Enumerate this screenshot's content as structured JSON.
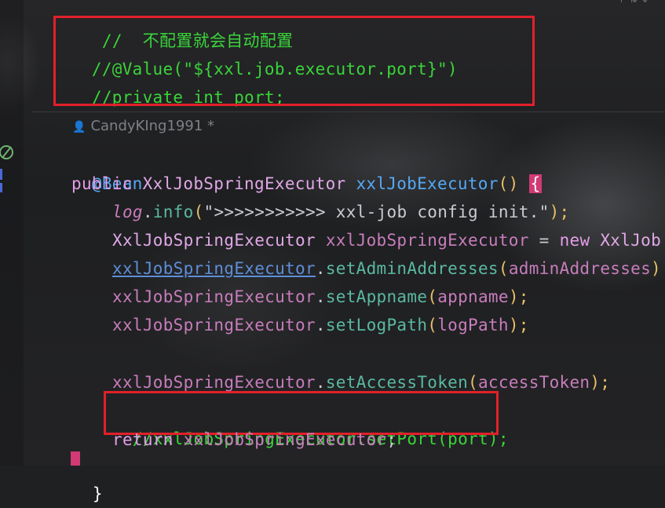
{
  "comment_top": "//  不配置就会自动配置",
  "line_value": "//@Value(\"${xxl.job.executor.port}\")",
  "line_private": "//private int port;",
  "author": "CandyKIng1991 *",
  "annotation": "@Bean",
  "sig": {
    "public": "public",
    "type": "XxlJobSpringExecutor",
    "name": "xxlJobExecutor",
    "parens": "()",
    "brace": "{"
  },
  "log": {
    "obj": "log",
    "dot": ".",
    "method": "info",
    "open": "(",
    "str": "\">>>>>>>>>>> xxl-job config init.\"",
    "close": ");"
  },
  "decl": {
    "type": "XxlJobSpringExecutor",
    "var": "xxlJobSpringExecutor",
    "eq": "=",
    "new": "new",
    "rest": "XxlJob"
  },
  "calls": [
    {
      "obj": "xxlJobSpringExecutor",
      "method": "setAdminAddresses",
      "arg": "adminAddresses",
      "end": ")"
    },
    {
      "obj": "xxlJobSpringExecutor",
      "method": "setAppname",
      "arg": "appname",
      "end": ");"
    },
    {
      "obj": "xxlJobSpringExecutor",
      "method": "setLogPath",
      "arg": "logPath",
      "end": ");"
    },
    {
      "obj": "xxlJobSpringExecutor",
      "method": "setAccessToken",
      "arg": "accessToken",
      "end": ");"
    }
  ],
  "line_setport": "//xxlJobSpringExecutor.setPort(port);",
  "ret": {
    "kw": "return",
    "var": "xxlJobSpringExecutor",
    "end": ";"
  },
  "closing": "}",
  "top_right": "↑  ⇅  ↓"
}
